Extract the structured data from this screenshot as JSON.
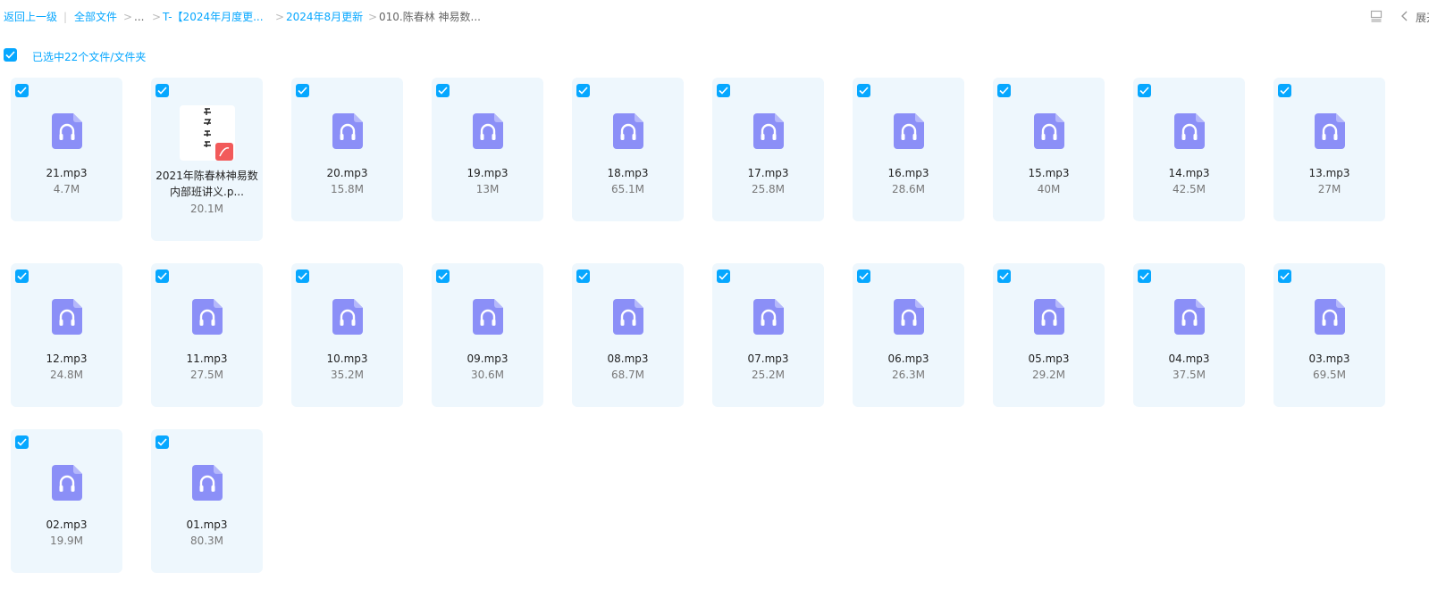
{
  "breadcrumb": {
    "back": "返回上一级",
    "items": [
      "全部文件",
      "...",
      "T-【2024年月度更...",
      "2024年8月更新"
    ],
    "current": "010.陈春林 神易数..."
  },
  "toolbar": {
    "expand_label": "展开"
  },
  "selection": {
    "label": "已选中22个文件/文件夹",
    "checked": true
  },
  "colors": {
    "accent": "#06a7ff",
    "card_bg": "#eef7fd",
    "audio_icon": "#8b8ff7",
    "pdf_badge": "#f25a5a"
  },
  "files": [
    {
      "name": "21.mp3",
      "size": "4.7M",
      "type": "audio-icon"
    },
    {
      "name": "2021年陈春林神易数内部班讲义.p...",
      "size": "20.1M",
      "type": "pdf-thumbnail"
    },
    {
      "name": "20.mp3",
      "size": "15.8M",
      "type": "audio-icon"
    },
    {
      "name": "19.mp3",
      "size": "13M",
      "type": "audio-icon"
    },
    {
      "name": "18.mp3",
      "size": "65.1M",
      "type": "audio-icon"
    },
    {
      "name": "17.mp3",
      "size": "25.8M",
      "type": "audio-icon"
    },
    {
      "name": "16.mp3",
      "size": "28.6M",
      "type": "audio-icon"
    },
    {
      "name": "15.mp3",
      "size": "40M",
      "type": "audio-icon"
    },
    {
      "name": "14.mp3",
      "size": "42.5M",
      "type": "audio-icon"
    },
    {
      "name": "13.mp3",
      "size": "27M",
      "type": "audio-icon"
    },
    {
      "name": "12.mp3",
      "size": "24.8M",
      "type": "audio-icon"
    },
    {
      "name": "11.mp3",
      "size": "27.5M",
      "type": "audio-icon"
    },
    {
      "name": "10.mp3",
      "size": "35.2M",
      "type": "audio-icon"
    },
    {
      "name": "09.mp3",
      "size": "30.6M",
      "type": "audio-icon"
    },
    {
      "name": "08.mp3",
      "size": "68.7M",
      "type": "audio-icon"
    },
    {
      "name": "07.mp3",
      "size": "25.2M",
      "type": "audio-icon"
    },
    {
      "name": "06.mp3",
      "size": "26.3M",
      "type": "audio-icon"
    },
    {
      "name": "05.mp3",
      "size": "29.2M",
      "type": "audio-icon"
    },
    {
      "name": "04.mp3",
      "size": "37.5M",
      "type": "audio-icon"
    },
    {
      "name": "03.mp3",
      "size": "69.5M",
      "type": "audio-icon"
    },
    {
      "name": "02.mp3",
      "size": "19.9M",
      "type": "audio-icon"
    },
    {
      "name": "01.mp3",
      "size": "80.3M",
      "type": "audio-icon"
    }
  ]
}
